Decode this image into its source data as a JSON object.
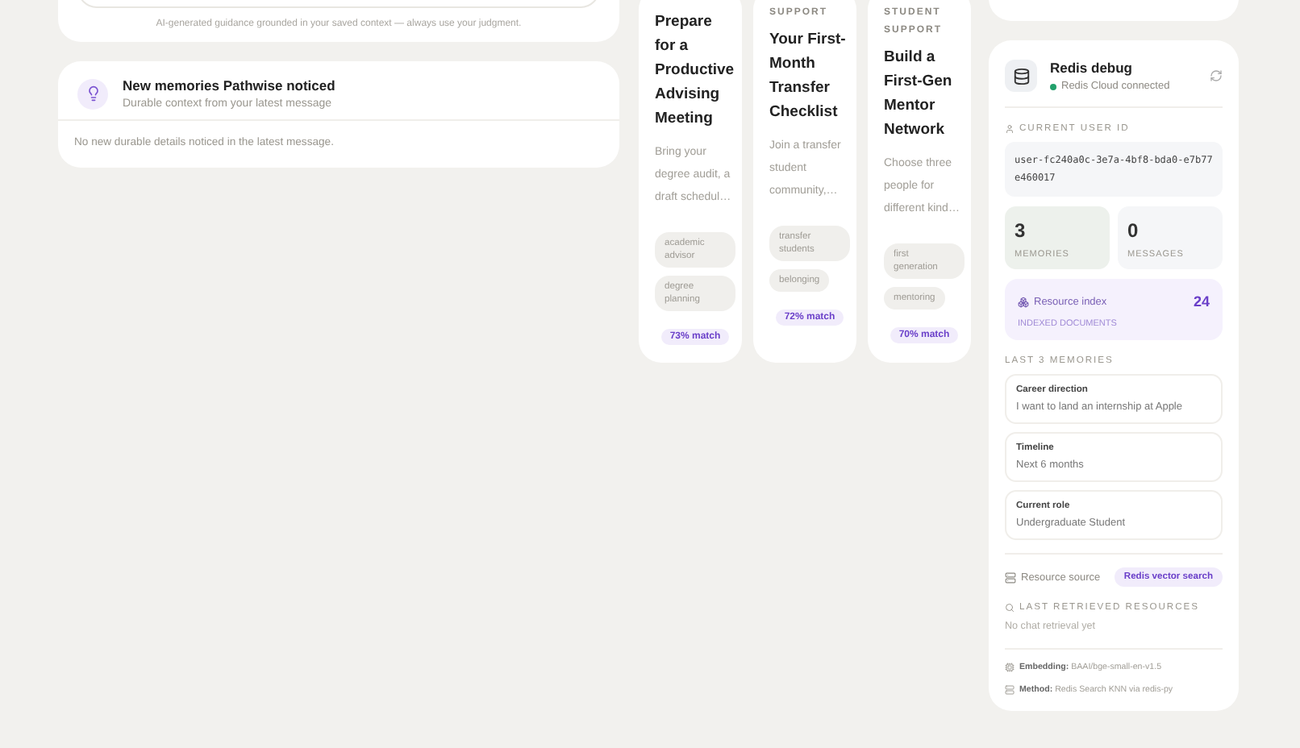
{
  "guidance_card": {
    "disclaimer": "AI-generated guidance grounded in your saved context — always use your judgment."
  },
  "memories_card": {
    "title": "New memories Pathwise noticed",
    "subtitle": "Durable context from your latest message",
    "empty_text": "No new durable details noticed in the latest message."
  },
  "resources": [
    {
      "title": "Prepare for a Productive Advising Meeting",
      "summary": "Bring your degree audit, a draft schedul…",
      "tags": [
        "academic advisor",
        "degree planning"
      ],
      "match": "73% match"
    },
    {
      "category": "SUPPORT",
      "title": "Your First-Month Transfer Checklist",
      "summary": "Join a transfer student community,…",
      "tags": [
        "transfer students",
        "belonging"
      ],
      "match": "72% match"
    },
    {
      "category": "STUDENT SUPPORT",
      "title": "Build a First-Gen Mentor Network",
      "summary": "Choose three people for different kind…",
      "tags": [
        "first generation",
        "mentoring"
      ],
      "match": "70% match"
    }
  ],
  "redis_debug": {
    "title": "Redis debug",
    "status": "Redis Cloud connected",
    "connected": true,
    "user_id_label": "CURRENT USER ID",
    "user_id": "user-fc240a0c-3e7a-4bf8-bda0-e7b77e460017",
    "stats": [
      {
        "value": "3",
        "label": "MEMORIES",
        "highlighted": true
      },
      {
        "value": "0",
        "label": "MESSAGES",
        "highlighted": false
      }
    ],
    "resource_index": {
      "label": "Resource index",
      "count": "24",
      "sublabel": "INDEXED DOCUMENTS"
    },
    "memories_heading": "LAST 3 MEMORIES",
    "memories": [
      {
        "label": "Career direction",
        "value": "I want to land an internship at Apple"
      },
      {
        "label": "Timeline",
        "value": "Next 6 months"
      },
      {
        "label": "Current role",
        "value": "Undergraduate Student"
      }
    ],
    "resource_source_label": "Resource source",
    "resource_source_badge": "Redis vector search",
    "retrieved_heading": "LAST RETRIEVED RESOURCES",
    "retrieved_empty": "No chat retrieval yet",
    "embedding": {
      "label": "Embedding:",
      "value": "BAAI/bge-small-en-v1.5"
    },
    "method": {
      "label": "Method:",
      "value": "Redis Search KNN via redis-py"
    }
  }
}
